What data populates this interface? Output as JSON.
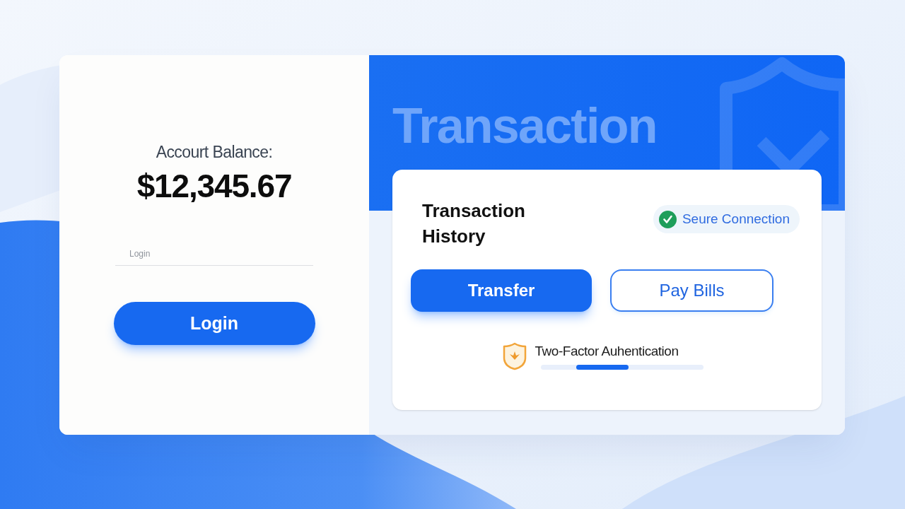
{
  "balance_panel": {
    "label": "Accourt Balance:",
    "amount": "$12,345.67",
    "login_field": {
      "placeholder": "Login"
    },
    "login_button": "Login"
  },
  "banner": {
    "title": "Transaction"
  },
  "history_card": {
    "title": "Transaction History",
    "badge": {
      "label": "Seure Connection"
    },
    "actions": [
      {
        "label": "Transfer",
        "kind": "primary"
      },
      {
        "label": "Pay Bills",
        "kind": "outline"
      }
    ],
    "two_factor": {
      "label": "Two-Factor Auhentication",
      "level": 0.32
    }
  }
}
